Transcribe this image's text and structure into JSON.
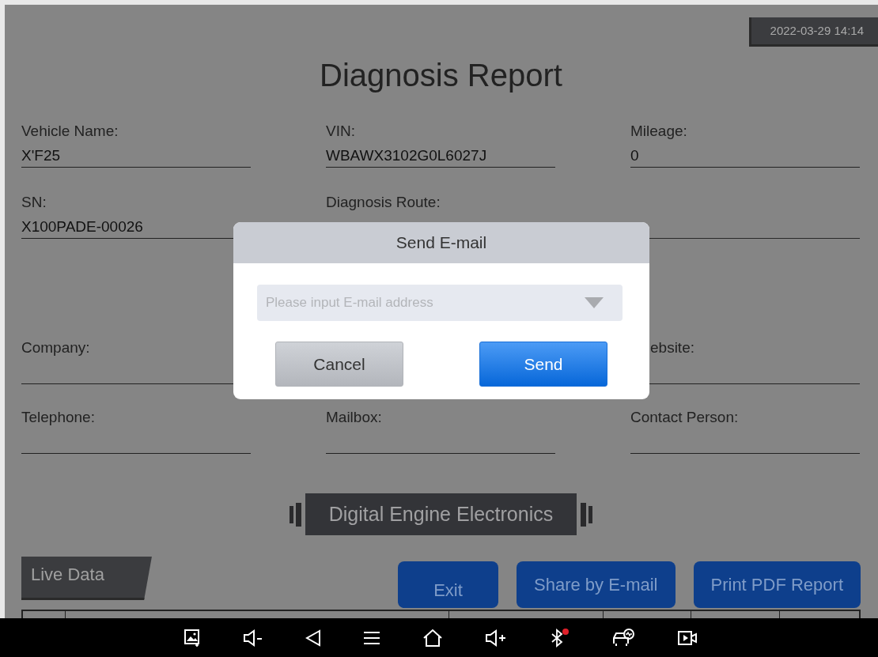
{
  "datetime": "2022-03-29 14:14",
  "title": "Diagnosis Report",
  "field_rows": [
    {
      "fields": [
        {
          "label": "Vehicle Name:",
          "value": "X'F25"
        },
        {
          "label": "VIN:",
          "value": "WBAWX3102G0L6027J"
        },
        {
          "label": "Mileage:",
          "value": "0"
        }
      ]
    },
    {
      "fields": [
        {
          "label": "SN:",
          "value": "X100PADE-00026"
        },
        {
          "label": "Diagnosis Route:"
        },
        {
          "kind": "blank"
        }
      ]
    },
    {
      "fields": [
        {
          "label": "Company:"
        },
        {
          "kind": "blank"
        },
        {
          "label": "ebsite:",
          "kind": "covered"
        }
      ]
    },
    {
      "fields": [
        {
          "label": "Telephone:"
        },
        {
          "label": "Mailbox:"
        },
        {
          "label": "Contact Person:"
        }
      ]
    }
  ],
  "banner": "Digital Engine Electronics",
  "section_tab": "Live Data",
  "buttons": [
    "Exit",
    "Share by E-mail",
    "Print PDF Report"
  ],
  "dialog": {
    "title": "Send E-mail",
    "placeholder": "Please input E-mail address",
    "buttons": [
      {
        "label": "Cancel",
        "kind": "secondary"
      },
      {
        "label": "Send",
        "kind": "primary"
      }
    ]
  },
  "nav_bar": {
    "bluetooth_error": true
  }
}
